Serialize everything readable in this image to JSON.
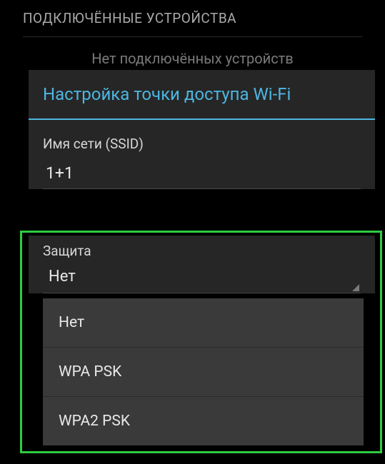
{
  "header": {
    "title": "ПОДКЛЮЧЁННЫЕ УСТРОЙСТВА"
  },
  "no_devices_text": "Нет подключённых устройств",
  "dialog": {
    "title": "Настройка точки доступа Wi-Fi",
    "ssid_label": "Имя сети (SSID)",
    "ssid_value": "1+1",
    "security_label": "Защита",
    "security_selected": "Нет"
  },
  "dropdown": {
    "options": [
      "Нет",
      "WPA PSK",
      "WPA2 PSK"
    ]
  },
  "colors": {
    "accent": "#4db6e2",
    "highlight": "#2ecc40"
  }
}
